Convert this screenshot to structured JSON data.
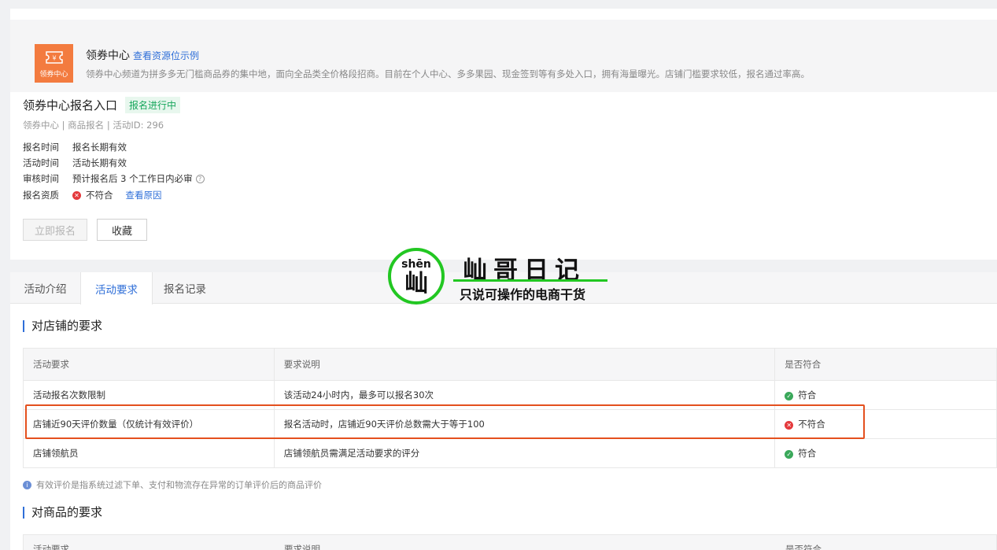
{
  "banner": {
    "logo_label": "领券中心",
    "title": "领券中心",
    "title_link": "查看资源位示例",
    "description": "领券中心频道为拼多多无门槛商品券的集中地，面向全品类全价格段招商。目前在个人中心、多多果园、现金签到等有多处入口，拥有海量曝光。店铺门槛要求较低，报名通过率高。"
  },
  "entry": {
    "title": "领券中心报名入口",
    "status_tag": "报名进行中",
    "subtitle": "领券中心 | 商品报名 | 活动ID: 296",
    "rows": [
      {
        "key": "报名时间",
        "value": "报名长期有效"
      },
      {
        "key": "活动时间",
        "value": "活动长期有效"
      },
      {
        "key": "审核时间",
        "value": "预计报名后 3 个工作日内必审"
      },
      {
        "key": "报名资质",
        "value": "不符合",
        "link": "查看原因"
      }
    ],
    "signup_button": "立即报名",
    "favorite_button": "收藏"
  },
  "tabs": [
    {
      "label": "活动介绍",
      "active": false
    },
    {
      "label": "活动要求",
      "active": true
    },
    {
      "label": "报名记录",
      "active": false
    }
  ],
  "store_section": {
    "title": "对店铺的要求",
    "headers": [
      "活动要求",
      "要求说明",
      "是否符合"
    ],
    "rows": [
      {
        "requirement": "活动报名次数限制",
        "description": "该活动24小时内，最多可以报名30次",
        "result": "符合",
        "ok": true
      },
      {
        "requirement": "店铺近90天评价数量（仅统计有效评价）",
        "description": "报名活动时，店铺近90天评价总数需大于等于100",
        "result": "不符合",
        "ok": false
      },
      {
        "requirement": "店铺领航员",
        "description": "店铺领航员需满足活动要求的评分",
        "result": "符合",
        "ok": true
      }
    ],
    "note": "有效评价是指系统过滤下单、支付和物流存在异常的订单评价后的商品评价"
  },
  "product_section": {
    "title": "对商品的要求",
    "headers": [
      "活动要求",
      "要求说明",
      "是否符合"
    ]
  },
  "watermark": {
    "pinyin": "shēn",
    "char": "屾",
    "name": "屾哥日记",
    "slogan": "只说可操作的电商干货"
  },
  "colors": {
    "accent": "#2f6fd8",
    "logo_bg": "#f37b3f",
    "success": "#16a65b",
    "error": "#e4393c",
    "highlight": "#e4501e",
    "watermark_green": "#22c722"
  }
}
